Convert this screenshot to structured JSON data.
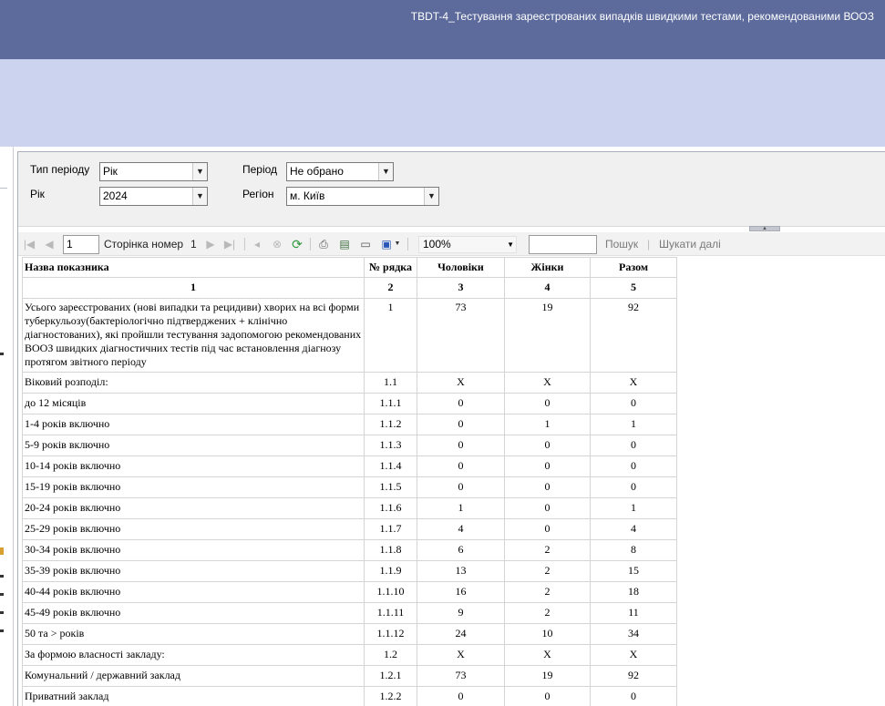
{
  "window": {
    "title": "TBDT-4_Тестування зареєстрованих випадків швидкими тестами, рекомендованими ВООЗ"
  },
  "params": {
    "period_type_label": "Тип періоду",
    "period_type_value": "Рік",
    "year_label": "Рік",
    "year_value": "2024",
    "period_label": "Період",
    "period_value": "Не обрано",
    "region_label": "Регіон",
    "region_value": "м. Київ"
  },
  "toolbar": {
    "page_value": "1",
    "page_of_label": "Сторінка номер",
    "page_total": "1",
    "zoom_value": "100%",
    "search_placeholder": "",
    "search_label": "Пошук",
    "search_separator": "|",
    "find_next_label": "Шукати далі"
  },
  "icons": {
    "first_page": "first-page-icon",
    "prev_page": "previous-page-icon",
    "next_page": "next-page-icon",
    "last_page": "last-page-icon",
    "back": "back-icon",
    "stop": "stop-icon",
    "refresh": "refresh-icon",
    "print": "print-icon",
    "print_layout": "print-layout-icon",
    "page_setup": "page-setup-icon",
    "export": "export-icon"
  },
  "colors": {
    "header_bar": "#5c6b9b",
    "band": "#cbd3ee",
    "refresh_icon": "#2e9a3c",
    "save_icon": "#2a56b8"
  },
  "report": {
    "headers": [
      "Назва показника",
      "№ рядка",
      "Чоловіки",
      "Жінки",
      "Разом"
    ],
    "column_numbers": [
      "1",
      "2",
      "3",
      "4",
      "5"
    ],
    "rows": [
      {
        "name": "Усього зареєстрованих (нові випадки та рецидиви) хворих на всі форми туберкульозу(бактеріологічно підтверджених + клінічно діагностованих), які пройшли тестування задопомогою рекомендованих ВООЗ швидких діагностичних тестів під час встановлення діагнозу протягом звітного періоду",
        "line": "1",
        "men": "73",
        "women": "19",
        "total": "92"
      },
      {
        "name": "Віковий розподіл:",
        "line": "1.1",
        "men": "X",
        "women": "X",
        "total": "X"
      },
      {
        "name": "до 12 місяців",
        "line": "1.1.1",
        "men": "0",
        "women": "0",
        "total": "0"
      },
      {
        "name": "1-4 років включно",
        "line": "1.1.2",
        "men": "0",
        "women": "1",
        "total": "1"
      },
      {
        "name": "5-9 років включно",
        "line": "1.1.3",
        "men": "0",
        "women": "0",
        "total": "0"
      },
      {
        "name": "10-14 років включно",
        "line": "1.1.4",
        "men": "0",
        "women": "0",
        "total": "0"
      },
      {
        "name": "15-19 років включно",
        "line": "1.1.5",
        "men": "0",
        "women": "0",
        "total": "0"
      },
      {
        "name": "20-24 років включно",
        "line": "1.1.6",
        "men": "1",
        "women": "0",
        "total": "1"
      },
      {
        "name": "25-29 років включно",
        "line": "1.1.7",
        "men": "4",
        "women": "0",
        "total": "4"
      },
      {
        "name": "30-34 років включно",
        "line": "1.1.8",
        "men": "6",
        "women": "2",
        "total": "8"
      },
      {
        "name": "35-39 років включно",
        "line": "1.1.9",
        "men": "13",
        "women": "2",
        "total": "15"
      },
      {
        "name": "40-44 років включно",
        "line": "1.1.10",
        "men": "16",
        "women": "2",
        "total": "18"
      },
      {
        "name": "45-49 років включно",
        "line": "1.1.11",
        "men": "9",
        "women": "2",
        "total": "11"
      },
      {
        "name": "50 та > років",
        "line": "1.1.12",
        "men": "24",
        "women": "10",
        "total": "34"
      },
      {
        "name": "За формою власності закладу:",
        "line": "1.2",
        "men": "X",
        "women": "X",
        "total": "X"
      },
      {
        "name": "Комунальний / державний заклад",
        "line": "1.2.1",
        "men": "73",
        "women": "19",
        "total": "92"
      },
      {
        "name": "Приватний заклад",
        "line": "1.2.2",
        "men": "0",
        "women": "0",
        "total": "0"
      }
    ]
  }
}
